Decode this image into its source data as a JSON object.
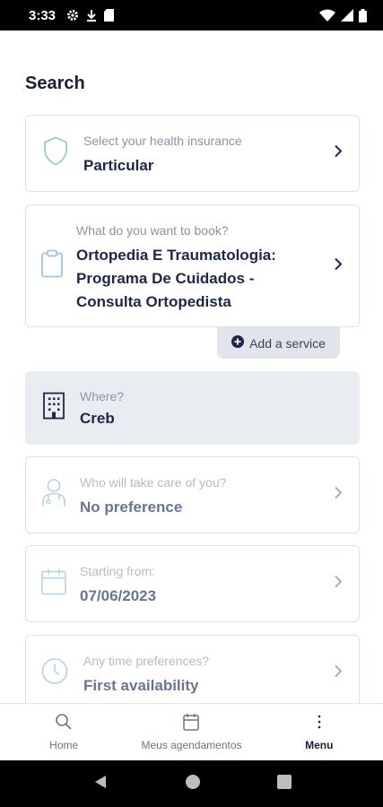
{
  "status_bar": {
    "time": "3:33"
  },
  "page": {
    "title": "Search"
  },
  "insurance": {
    "label": "Select your health insurance",
    "value": "Particular"
  },
  "service": {
    "label": "What do you want to book?",
    "value_lines": [
      "Ortopedia E Traumatologia:",
      "Programa De Cuidados -",
      "Consulta Ortopedista"
    ]
  },
  "add_service": {
    "label": "Add a service"
  },
  "where": {
    "label": "Where?",
    "value": "Creb"
  },
  "provider": {
    "label": "Who will take care of you?",
    "value": "No preference"
  },
  "starting": {
    "label": "Starting from:",
    "value": "07/06/2023"
  },
  "time_pref": {
    "label": "Any time preferences?",
    "value": "First availability"
  },
  "bottom_nav": {
    "home": "Home",
    "appointments": "Meus agendamentos",
    "menu": "Menu"
  },
  "colors": {
    "primary_text": "#1d2748",
    "label_text": "#8c93a3",
    "icon_blue": "#9fc7db",
    "disabled_bg": "#e9edf2"
  }
}
